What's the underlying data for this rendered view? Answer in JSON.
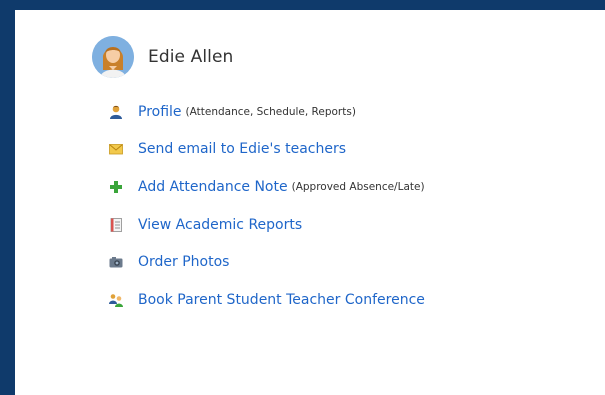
{
  "student": {
    "name": "Edie Allen"
  },
  "links": [
    {
      "icon": "profile-icon",
      "label": "Profile",
      "note": "(Attendance, Schedule, Reports)"
    },
    {
      "icon": "email-icon",
      "label": "Send email to Edie's teachers",
      "note": ""
    },
    {
      "icon": "add-icon",
      "label": "Add Attendance Note",
      "note": "(Approved Absence/Late)"
    },
    {
      "icon": "report-icon",
      "label": "View Academic Reports",
      "note": ""
    },
    {
      "icon": "camera-icon",
      "label": "Order Photos",
      "note": ""
    },
    {
      "icon": "conference-icon",
      "label": "Book Parent Student Teacher Conference",
      "note": ""
    }
  ],
  "colors": {
    "frame": "#0f3a6b",
    "link": "#1f66c9",
    "text": "#333333"
  }
}
